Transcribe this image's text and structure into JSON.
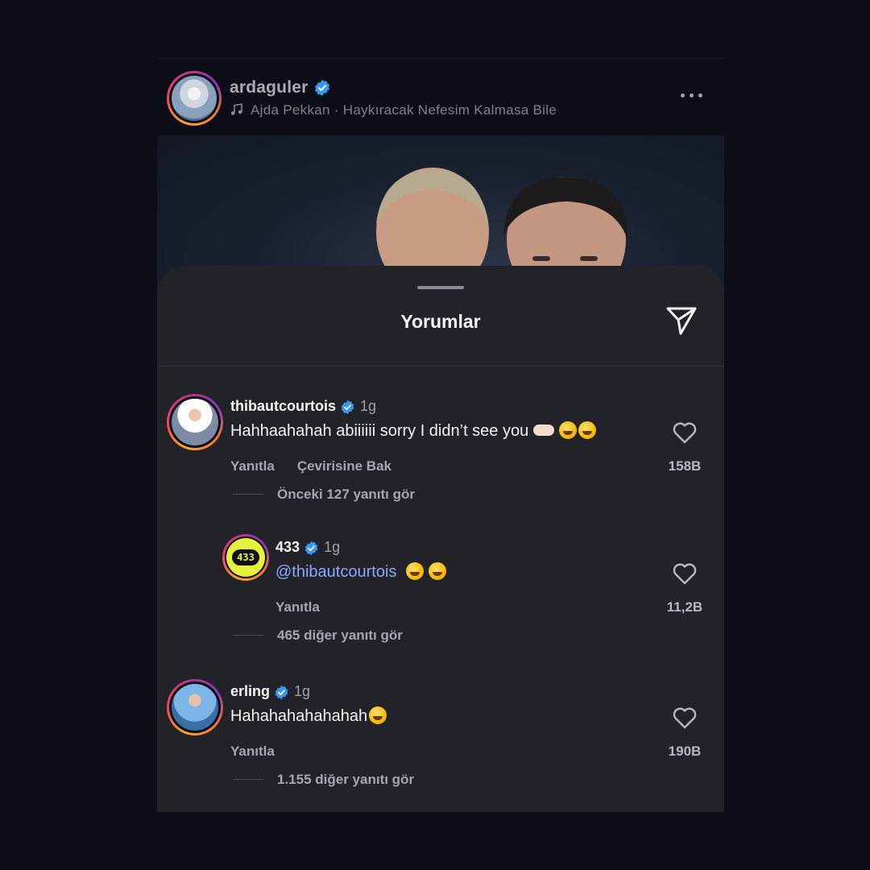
{
  "post": {
    "username": "ardaguler",
    "music": "Ajda Pekkan · Haykıracak Nefesim Kalmasa Bile"
  },
  "sheet": {
    "title": "Yorumlar"
  },
  "comments": [
    {
      "username": "thibautcourtois",
      "time": "1g",
      "text": "Hahhaahahah abiiiiii sorry I didn’t see you",
      "reply_label": "Yanıtla",
      "translate_label": "Çevirisine Bak",
      "likes": "158B",
      "more_replies": "Önceki 127 yanıtı gör"
    },
    {
      "username": "433",
      "time": "1g",
      "mention": "@thibautcourtois",
      "reply_label": "Yanıtla",
      "likes": "11,2B",
      "more_replies": "465 diğer yanıtı gör"
    },
    {
      "username": "erling",
      "time": "1g",
      "text": "Hahahahahahahah",
      "reply_label": "Yanıtla",
      "likes": "190B",
      "more_replies": "1.155 diğer yanıtı gör"
    }
  ],
  "colors": {
    "background": "#0b0e17",
    "sheet": "#212329",
    "verified": "#3897f0",
    "mention": "#8ea7ff"
  }
}
